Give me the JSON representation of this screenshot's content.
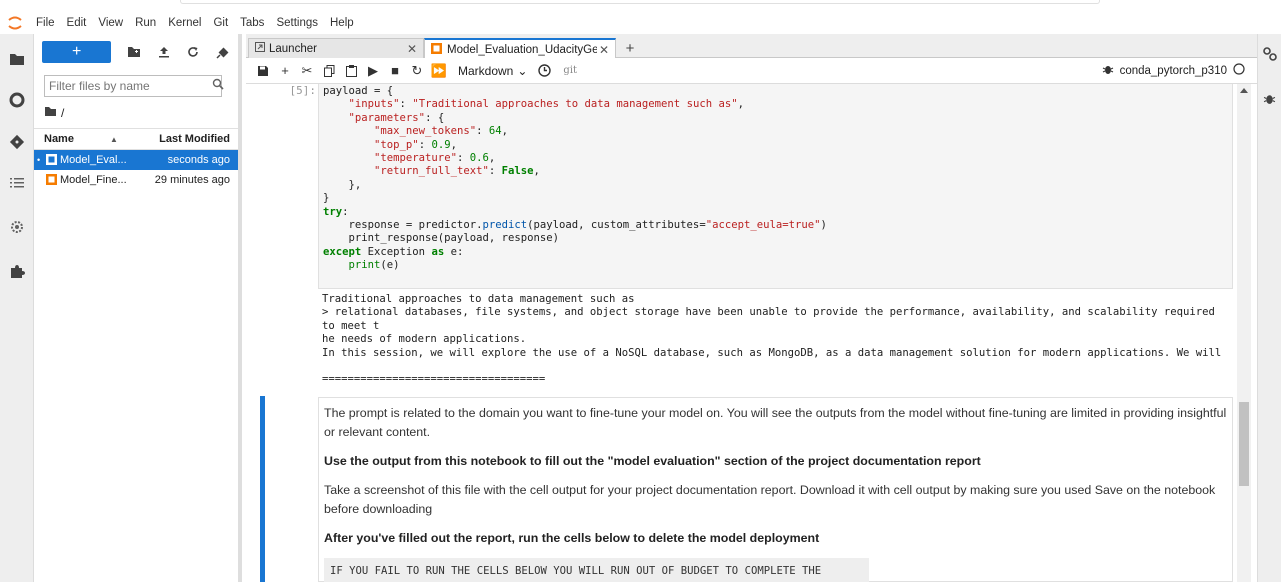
{
  "menubar": {
    "items": [
      "File",
      "Edit",
      "View",
      "Run",
      "Kernel",
      "Git",
      "Tabs",
      "Settings",
      "Help"
    ]
  },
  "activity_icons": [
    "folder-icon",
    "running-icon",
    "git-icon",
    "toc-icon",
    "extension-manager-icon",
    "puzzle-icon"
  ],
  "filebrowser": {
    "new_label": "+",
    "filter_placeholder": "Filter files by name",
    "breadcrumb": "/",
    "col_name": "Name",
    "col_modified": "Last Modified",
    "files": [
      {
        "name": "Model_Eval...",
        "modified": "seconds ago",
        "selected": true
      },
      {
        "name": "Model_Fine...",
        "modified": "29 minutes ago",
        "selected": false
      }
    ]
  },
  "tabs": [
    {
      "label": "Launcher",
      "active": false
    },
    {
      "label": "Model_Evaluation_UdacityGe",
      "active": true
    }
  ],
  "notebook_toolbar": {
    "cell_type": "Markdown",
    "git_label": "git",
    "kernel_name": "conda_pytorch_p310"
  },
  "code_cell": {
    "prompt": "[5]:"
  },
  "output": {
    "line1": "Traditional approaches to data management such as",
    "line2": "> relational databases, file systems, and object storage have been unable to provide the performance, availability, and scalability required to meet t",
    "line3": "he needs of modern applications.",
    "line4": "In this session, we will explore the use of a NoSQL database, such as MongoDB, as a data management solution for modern applications. We will",
    "line5": "==================================="
  },
  "markdown_cell": {
    "p1": "The prompt is related to the domain you want to fine-tune your model on. You will see the outputs from the model without fine-tuning are limited in providing insightful or relevant content.",
    "h1": "Use the output from this notebook to fill out the \"model evaluation\" section of the project documentation report",
    "p2": "Take a screenshot of this file with the cell output for your project documentation report. Download it with cell output by making sure you used Save on the notebook before downloading",
    "h2": "After you've filled out the report, run the cells below to delete the model deployment",
    "code": "IF YOU FAIL TO RUN THE CELLS BELOW YOU WILL RUN OUT OF BUDGET TO COMPLETE THE PROJECT"
  },
  "colors": {
    "accent": "#1976d2",
    "notebook_icon": "#f57c00"
  }
}
